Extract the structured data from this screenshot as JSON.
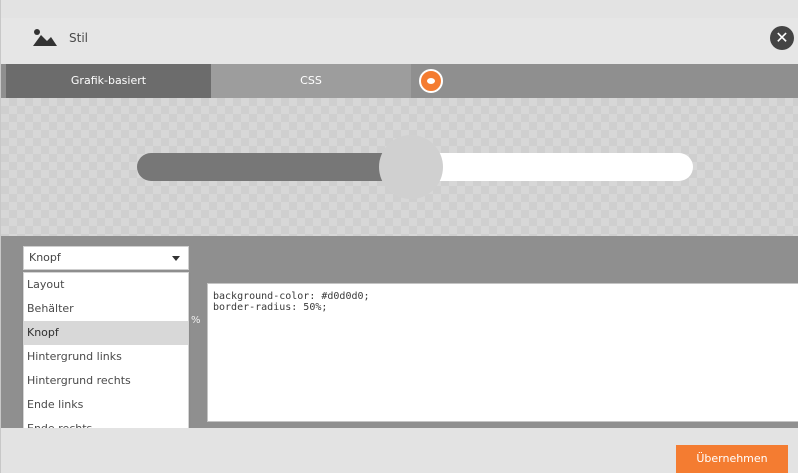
{
  "window": {
    "title": "Stil",
    "close_label": "✕"
  },
  "tabs": [
    {
      "label": "Grafik-basiert"
    },
    {
      "label": "CSS"
    }
  ],
  "element_select": {
    "value": "Knopf",
    "options": [
      "Layout",
      "Behälter",
      "Knopf",
      "Hintergrund links",
      "Hintergrund rechts",
      "Ende links",
      "Ende rechts"
    ],
    "selected_index": 2
  },
  "css_text": "background-color: #d0d0d0;\nborder-radius: 50%;",
  "stray_char": "%",
  "preview": {
    "slider_value": 0.5
  },
  "footer": {
    "apply_label": "Übernehmen"
  },
  "colors": {
    "accent": "#f47c31",
    "knob": "#d0d0d0"
  }
}
